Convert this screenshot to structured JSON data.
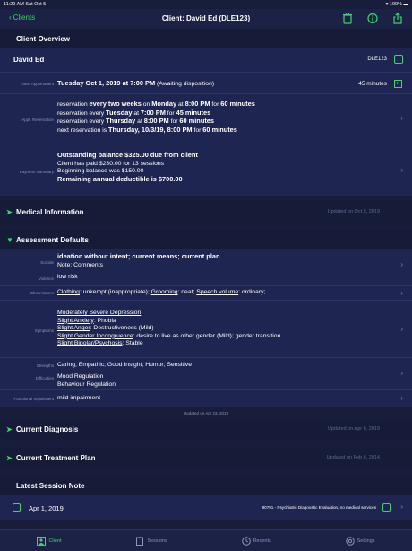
{
  "status_bar": {
    "time": "11:29 AM  Sat Oct 5",
    "battery": "100%"
  },
  "nav": {
    "back_label": "Clients",
    "title": "Client:  David Ed  (DLE123)"
  },
  "client_overview": {
    "header": "Client Overview",
    "name": "David Ed",
    "code": "DLE123",
    "next_appointment_label": "Next Appointment",
    "next_appointment_value": "Tuesday Oct 1, 2019 at 7:00 PM",
    "next_appointment_note": "(Awaiting disposition)",
    "next_appointment_duration": "45 minutes",
    "reservation_label": "Appt. Reservation",
    "reservation_lines": [
      [
        "reservation ",
        "every two weeks",
        " on ",
        "Monday",
        " at ",
        "8:00 PM",
        " for ",
        "60 minutes"
      ],
      [
        "reservation every ",
        "Tuesday",
        " at ",
        "7:00 PM",
        " for ",
        "45 minutes"
      ],
      [
        "reservation every ",
        "Thursday",
        " at ",
        "8:00 PM",
        " for ",
        "60 minutes"
      ],
      [
        "next reservation is ",
        "Thursday,  10/3/19, 8:00 PM",
        " for ",
        "60 minutes"
      ]
    ],
    "payment_label": "Payment Summary",
    "payment_lines": {
      "outstanding": "Outstanding balance $325.00 due from client",
      "paid": "Client has paid $230.00 for 13 sessions",
      "beginning": "Beginning balance was $150.00",
      "deductible": "Remaining annual deductible is $700.00"
    }
  },
  "medical_information": {
    "header": "Medical Information",
    "updated": "Updated on Oct 5, 2019"
  },
  "assessment": {
    "header": "Assessment Defaults",
    "suicide_label": "Suicide",
    "suicide_value": "ideation without intent; current means; current plan",
    "suicide_note": "Note: Comments",
    "violence_label": "Violence",
    "violence_value": "low risk",
    "observations_label": "Observations",
    "obs": [
      {
        "k": "Clothing",
        "v": ": unkempt (inappropriate); "
      },
      {
        "k": "Grooming",
        "v": ": neat; "
      },
      {
        "k": "Speech volume",
        "v": ": ordinary;"
      }
    ],
    "symptoms_label": "Symptoms",
    "symptoms": [
      {
        "k": "Moderately Severe Depression",
        "v": ""
      },
      {
        "k": "Slight Anxiety",
        "v": ": Phobia"
      },
      {
        "k": "Slight Anger",
        "v": ": Destructiveness (Mild)"
      },
      {
        "k": "Slight Gender Incongruence",
        "v": ": desire to live as other gender (Mild); gender transition"
      },
      {
        "k": "Slight Bipolar/Psychosis",
        "v": ": Stable"
      }
    ],
    "strengths_label": "Strengths",
    "strengths_value": "Caring; Empathic; Good Insight; Humor; Sensitive",
    "difficulties_label": "Difficulties",
    "difficulties_1": "Mood Regulation",
    "difficulties_2": "Behaviour Regulation",
    "functional_label": "Functional Impairment",
    "functional_value": "mild impairment",
    "updated": "Updated on Apr 23, 2019"
  },
  "current_diagnosis": {
    "header": "Current Diagnosis",
    "updated": "Updated on Apr 6, 2019"
  },
  "treatment_plan": {
    "header": "Current Treatment Plan",
    "updated": "Updated on Feb 6, 2014"
  },
  "latest_session": {
    "header": "Latest Session Note",
    "date": "Apr 1, 2019",
    "code": "90791 - Psychiatric Diagnostic Evaluation, no medical services"
  },
  "tabs": [
    "Client",
    "Sessions",
    "Recents",
    "Settings"
  ],
  "colors": {
    "accent": "#3ed36b",
    "bg": "#171d3a",
    "panel": "#1e2550"
  }
}
